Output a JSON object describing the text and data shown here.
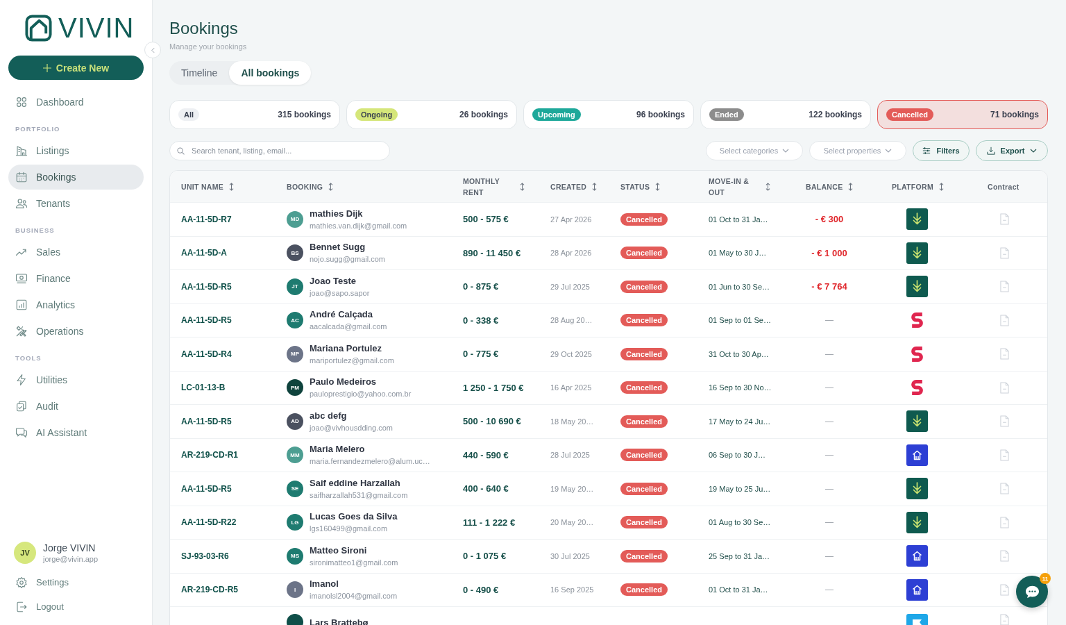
{
  "sidebar": {
    "logo": "VIVIN",
    "create_button": "Create New",
    "nav": [
      {
        "items": [
          {
            "label": "Dashboard",
            "selected": false
          }
        ]
      },
      {
        "heading": "PORTFOLIO",
        "items": [
          {
            "label": "Listings",
            "selected": false
          },
          {
            "label": "Bookings",
            "selected": true
          },
          {
            "label": "Tenants",
            "selected": false
          }
        ]
      },
      {
        "heading": "BUSINESS",
        "items": [
          {
            "label": "Sales",
            "selected": false
          },
          {
            "label": "Finance",
            "selected": false
          },
          {
            "label": "Analytics",
            "selected": false
          },
          {
            "label": "Operations",
            "selected": false
          }
        ]
      },
      {
        "heading": "TOOLS",
        "items": [
          {
            "label": "Utilities",
            "selected": false
          },
          {
            "label": "Audit",
            "selected": false
          },
          {
            "label": "AI Assistant",
            "selected": false
          }
        ]
      }
    ],
    "user": {
      "initials": "JV",
      "name": "Jorge VIVIN",
      "email": "jorge@vivin.app"
    },
    "footer_links": [
      {
        "label": "Settings"
      },
      {
        "label": "Logout"
      }
    ]
  },
  "header": {
    "title": "Bookings",
    "subtitle": "Manage your bookings"
  },
  "view_tabs": [
    {
      "label": "Timeline",
      "selected": false
    },
    {
      "label": "All bookings",
      "selected": true
    }
  ],
  "status_cards": [
    {
      "badge": "All",
      "count": "315 bookings",
      "color": "#eef0f3",
      "selected": false
    },
    {
      "badge": "Ongoing",
      "count": "26 bookings",
      "color": "#d5e67a",
      "selected": false
    },
    {
      "badge": "Upcoming",
      "count": "96 bookings",
      "color": "#1ea89a",
      "selected": false
    },
    {
      "badge": "Ended",
      "count": "122 bookings",
      "color": "#8c8c8c",
      "selected": false
    },
    {
      "badge": "Cancelled",
      "count": "71 bookings",
      "color": "#e35b58",
      "selected": true
    }
  ],
  "toolbar": {
    "search": {
      "placeholder": "Search tenant, listing, email..."
    },
    "dropdowns": [
      {
        "placeholder": "Select categories"
      },
      {
        "placeholder": "Select properties"
      }
    ],
    "buttons": [
      {
        "label": "Filters",
        "kind": "filters"
      },
      {
        "label": "Export",
        "kind": "export"
      }
    ]
  },
  "table": {
    "columns": [
      {
        "label": "UNIT NAME",
        "sortable": true
      },
      {
        "label": "BOOKING",
        "sortable": true
      },
      {
        "label": "MONTHLY RENT",
        "sortable": true
      },
      {
        "label": "CREATED",
        "sortable": true
      },
      {
        "label": "STATUS",
        "sortable": true
      },
      {
        "label": "MOVE-IN & OUT",
        "sortable": true
      },
      {
        "label": "BALANCE",
        "sortable": true
      },
      {
        "label": "PLATFORM",
        "sortable": true
      },
      {
        "label": "Contract",
        "sortable": false
      }
    ],
    "rows": [
      {
        "unit": "AA-11-5D-R7",
        "tenant": {
          "initials": "MD",
          "color": "#4d9e92",
          "name": "mathies Dijk",
          "email": "mathies.van.dijk@gmail.com"
        },
        "rent": "500 - 575 €",
        "created": "27 Apr 2026",
        "status": "Cancelled",
        "period": "01 Oct to 31 Ja…",
        "balance": {
          "text": "- € 300",
          "kind": "debt"
        },
        "platform": {
          "kind": "download"
        }
      },
      {
        "unit": "AA-11-5D-A",
        "tenant": {
          "initials": "BS",
          "color": "#4b5160",
          "name": "Bennet Sugg",
          "email": "nojo.sugg@gmail.com"
        },
        "rent": "890 - 11 450 €",
        "created": "28 Apr 2026",
        "status": "Cancelled",
        "period": "01 May to 30 J…",
        "balance": {
          "text": "- € 1 000",
          "kind": "debt"
        },
        "platform": {
          "kind": "download"
        }
      },
      {
        "unit": "AA-11-5D-R5",
        "tenant": {
          "initials": "JT",
          "color": "#1e7b70",
          "name": "Joao Teste",
          "email": "joao@sapo.sapor"
        },
        "rent": "0 - 875 €",
        "created": "29 Jul 2025",
        "status": "Cancelled",
        "period": "01 Jun to 30 Se…",
        "balance": {
          "text": "- € 7 764",
          "kind": "debt"
        },
        "platform": {
          "kind": "download"
        }
      },
      {
        "unit": "AA-11-5D-R5",
        "tenant": {
          "initials": "AC",
          "color": "#1e7b70",
          "name": "André Calçada",
          "email": "aacalcada@gmail.com"
        },
        "rent": "0 - 338 €",
        "created": "28 Aug 20…",
        "status": "Cancelled",
        "period": "01 Sep to 01 Se…",
        "balance": {
          "text": "—",
          "kind": "none"
        },
        "platform": {
          "kind": "s"
        }
      },
      {
        "unit": "AA-11-5D-R4",
        "tenant": {
          "initials": "MP",
          "color": "#6c7488",
          "name": "Mariana Portulez",
          "email": "mariportulez@gmail.com"
        },
        "rent": "0 - 775 €",
        "created": "29 Oct 2025",
        "status": "Cancelled",
        "period": "31 Oct to 30 Ap…",
        "balance": {
          "text": "—",
          "kind": "none"
        },
        "platform": {
          "kind": "s"
        }
      },
      {
        "unit": "LC-01-13-B",
        "tenant": {
          "initials": "PM",
          "color": "#0f433d",
          "name": "Paulo Medeiros",
          "email": "pauloprestigio@yahoo.com.br"
        },
        "rent": "1 250 - 1 750 €",
        "created": "16 Apr 2025",
        "status": "Cancelled",
        "period": "16 Sep to 30 No…",
        "balance": {
          "text": "—",
          "kind": "none"
        },
        "platform": {
          "kind": "s"
        }
      },
      {
        "unit": "AA-11-5D-R5",
        "tenant": {
          "initials": "AD",
          "color": "#4b5160",
          "name": "abc defg",
          "email": "joao@vivhousdding.com"
        },
        "rent": "500 - 10 690 €",
        "created": "18 May 20…",
        "status": "Cancelled",
        "period": "17 May to 24 Ju…",
        "balance": {
          "text": "—",
          "kind": "none"
        },
        "platform": {
          "kind": "download"
        }
      },
      {
        "unit": "AR-219-CD-R1",
        "tenant": {
          "initials": "MM",
          "color": "#4d9e92",
          "name": "Maria Melero",
          "email": "maria.fernandezmelero@alum.uc…"
        },
        "rent": "440 - 590 €",
        "created": "28 Jul 2025",
        "status": "Cancelled",
        "period": "06 Sep to 30 J…",
        "balance": {
          "text": "—",
          "kind": "none"
        },
        "platform": {
          "kind": "house"
        }
      },
      {
        "unit": "AA-11-5D-R5",
        "tenant": {
          "initials": "SE",
          "color": "#1e7b70",
          "name": "Saif eddine Harzallah",
          "email": "saifharzallah531@gmail.com"
        },
        "rent": "400 - 640 €",
        "created": "19 May 20…",
        "status": "Cancelled",
        "period": "19 May to 25 Ju…",
        "balance": {
          "text": "—",
          "kind": "none"
        },
        "platform": {
          "kind": "download"
        }
      },
      {
        "unit": "AA-11-5D-R22",
        "tenant": {
          "initials": "LG",
          "color": "#1e7b70",
          "name": "Lucas Goes da Silva",
          "email": "lgs160499@gmail.com"
        },
        "rent": "111 - 1 222 €",
        "created": "20 May 20…",
        "status": "Cancelled",
        "period": "01 Aug to 30 Se…",
        "balance": {
          "text": "—",
          "kind": "none"
        },
        "platform": {
          "kind": "download"
        }
      },
      {
        "unit": "SJ-93-03-R6",
        "tenant": {
          "initials": "MS",
          "color": "#1e7b70",
          "name": "Matteo Sironi",
          "email": "sironimatteo1@gmail.com"
        },
        "rent": "0 - 1 075 €",
        "created": "30 Jul 2025",
        "status": "Cancelled",
        "period": "25 Sep to 31 Ja…",
        "balance": {
          "text": "—",
          "kind": "none"
        },
        "platform": {
          "kind": "house"
        }
      },
      {
        "unit": "AR-219-CD-R5",
        "tenant": {
          "initials": "I",
          "color": "#6c7488",
          "name": "Imanol",
          "email": "imanolsl2004@gmail.com"
        },
        "rent": "0 - 490 €",
        "created": "16 Sep 2025",
        "status": "Cancelled",
        "period": "01 Oct to 31 Ja…",
        "balance": {
          "text": "—",
          "kind": "none"
        },
        "platform": {
          "kind": "house"
        }
      },
      {
        "tenant": {
          "color": "#0f4f49",
          "name": "Lars Brattebø"
        },
        "platform": {
          "kind": "flag"
        }
      }
    ]
  },
  "chat": {
    "badge": "11"
  }
}
